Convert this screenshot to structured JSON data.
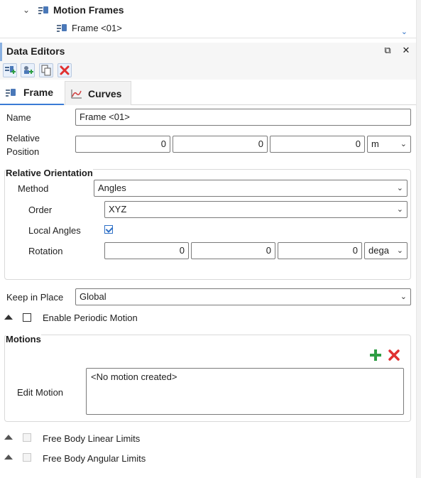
{
  "tree": {
    "parent_label": "Motion Frames",
    "child_label": "Frame <01>"
  },
  "panel": {
    "title": "Data Editors",
    "restore_glyph": "⧉",
    "close_glyph": "✕"
  },
  "tabs": [
    {
      "label": "Frame",
      "icon": "frame-icon",
      "active": true
    },
    {
      "label": "Curves",
      "icon": "curve-chart-icon",
      "active": false
    }
  ],
  "form": {
    "name_label": "Name",
    "name_value": "Frame <01>",
    "rel_pos_label_1": "Relative",
    "rel_pos_label_2": "Position",
    "pos_x": "0",
    "pos_y": "0",
    "pos_z": "0",
    "pos_unit": "m",
    "orientation_title": "Relative Orientation",
    "method_label": "Method",
    "method_value": "Angles",
    "order_label": "Order",
    "order_value": "XYZ",
    "local_angles_label": "Local Angles",
    "local_angles_checked": true,
    "rotation_label": "Rotation",
    "rot_x": "0",
    "rot_y": "0",
    "rot_z": "0",
    "rot_unit": "dega",
    "keep_label": "Keep in Place",
    "keep_value": "Global",
    "periodic_label": "Enable Periodic Motion",
    "motions_title": "Motions",
    "edit_motion_label": "Edit Motion",
    "motion_list_text": "<No motion created>",
    "linear_limits_label": "Free Body Linear Limits",
    "angular_limits_label": "Free Body Angular Limits"
  },
  "colors": {
    "accent": "#3a7bd5",
    "add_green": "#2e9e44",
    "delete_red": "#e03030"
  }
}
